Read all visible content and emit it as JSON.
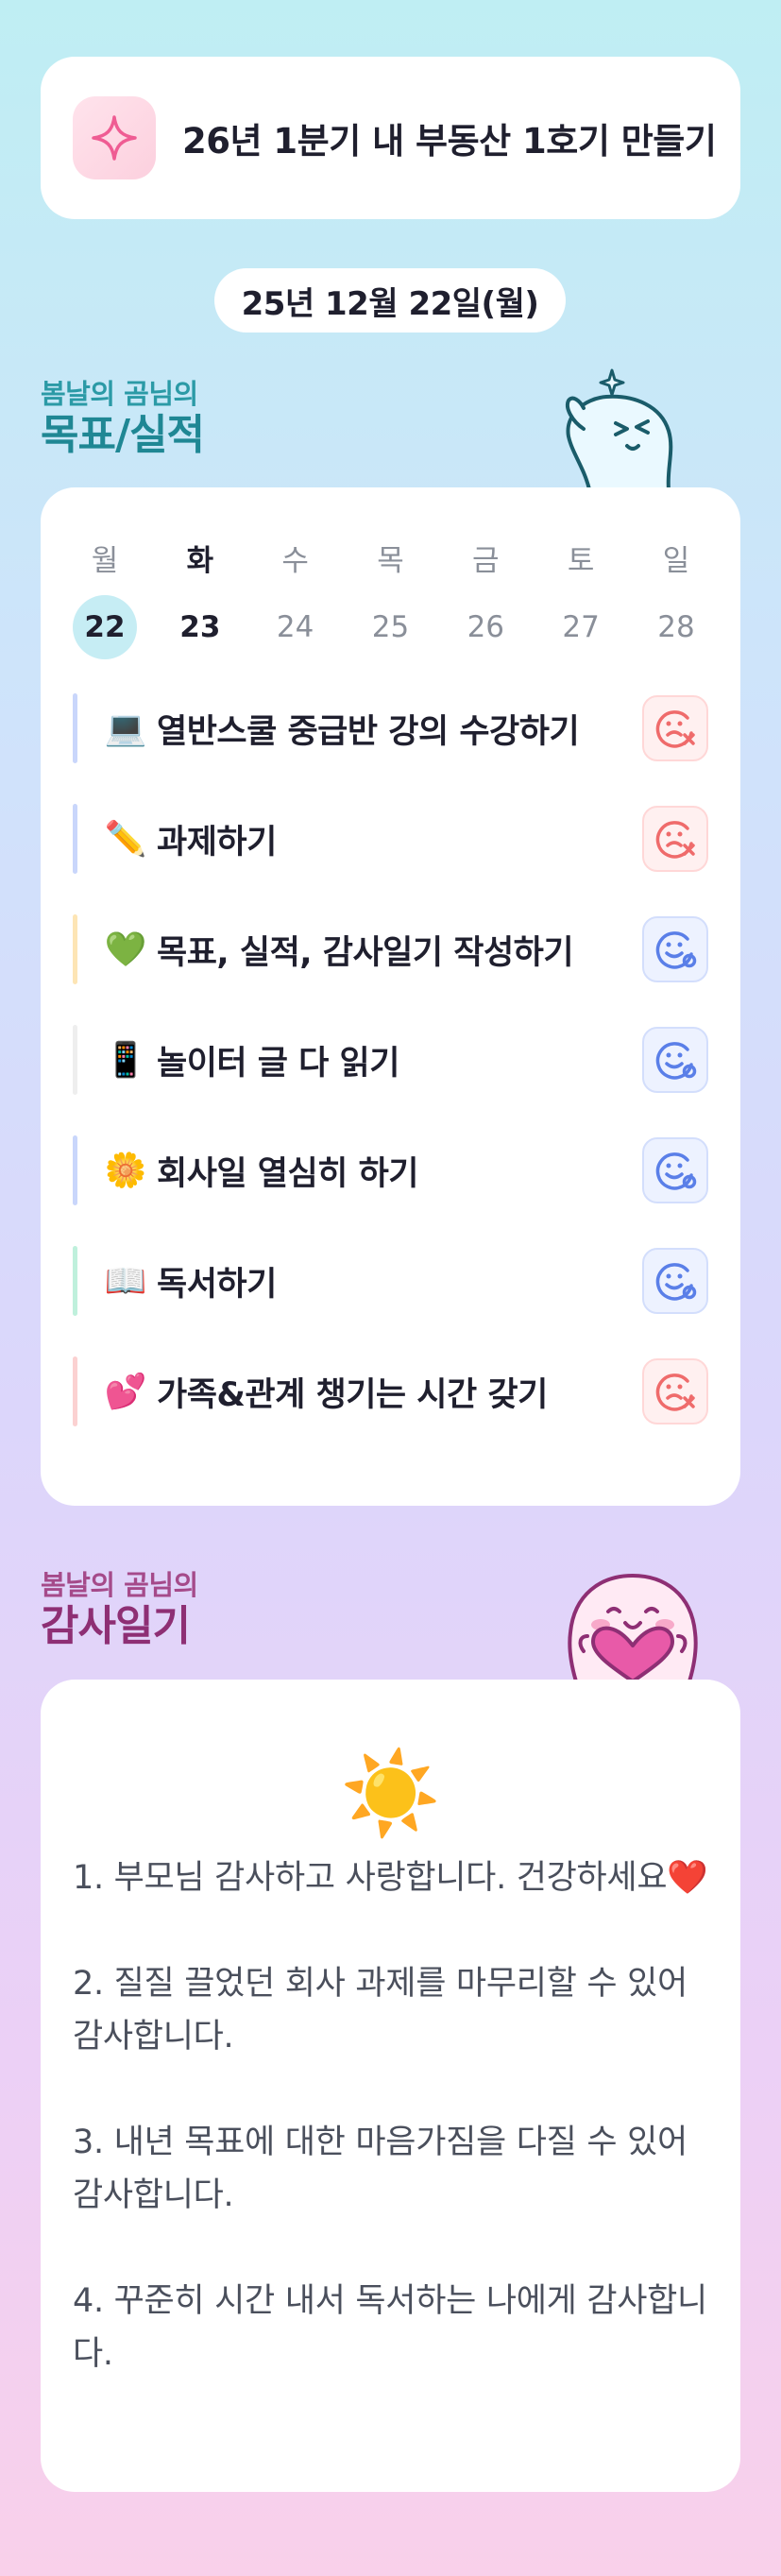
{
  "goal": {
    "icon": "sparkle-icon",
    "title": "26년 1분기 내 부동산 1호기 만들기"
  },
  "date": "25년 12월 22일(월)",
  "goals_section": {
    "subtitle": "봄날의 곰님의",
    "title": "목표/실적"
  },
  "week": {
    "days": [
      "월",
      "화",
      "수",
      "목",
      "금",
      "토",
      "일"
    ],
    "dates": [
      "22",
      "23",
      "24",
      "25",
      "26",
      "27",
      "28"
    ],
    "selected_index": 0
  },
  "tasks": [
    {
      "emoji": "💻",
      "label": "열반스쿨 중급반 강의 수강하기",
      "status": "not-done",
      "bar_color": "#c9d6fb"
    },
    {
      "emoji": "✏️",
      "label": "과제하기",
      "status": "not-done",
      "bar_color": "#c9d6fb"
    },
    {
      "emoji": "💚",
      "label": "목표, 실적, 감사일기 작성하기",
      "status": "done",
      "bar_color": "#fde5b5"
    },
    {
      "emoji": "📱",
      "label": "놀이터 글 다 읽기",
      "status": "done",
      "bar_color": "#eeeeee"
    },
    {
      "emoji": "🌼",
      "label": "회사일 열심히 하기",
      "status": "done",
      "bar_color": "#c9d6fb"
    },
    {
      "emoji": "📖",
      "label": "독서하기",
      "status": "done",
      "bar_color": "#bff0dc"
    },
    {
      "emoji": "💕",
      "label": "가족&관계 챙기는 시간 갖기",
      "status": "not-done",
      "bar_color": "#fbd1d1"
    }
  ],
  "thanks_section": {
    "subtitle": "봄날의 곰님의",
    "title": "감사일기"
  },
  "gratitude": {
    "weather_emoji": "☀️",
    "items": [
      "1. 부모님 감사하고 사랑합니다. 건강하세요❤️",
      "2. 질질 끌었던 회사 과제를 마무리할 수 있어 감사합니다.",
      "3. 내년 목표에 대한 마음가짐을 다질 수 있어 감사합니다.",
      "4. 꾸준히 시간 내서 독서하는 나에게 감사합니다."
    ]
  },
  "colors": {
    "teal": "#1f8794",
    "plum": "#8e2f74",
    "bad": "#ef6b6b",
    "good": "#5a7fe8"
  }
}
